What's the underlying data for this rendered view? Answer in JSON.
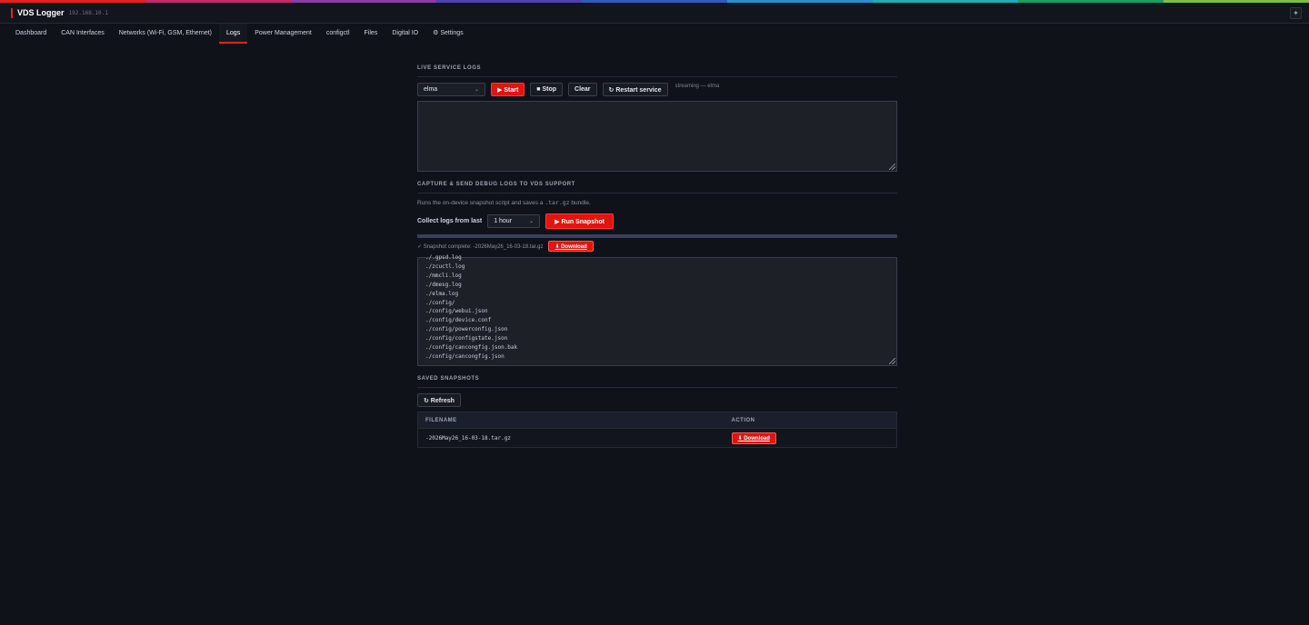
{
  "rainbow_colors": [
    "#e1231f",
    "#c62a6a",
    "#8e3aa8",
    "#4e43b0",
    "#2f5bbd",
    "#2a8ccf",
    "#1bb0b8",
    "#19a060",
    "#78c043"
  ],
  "app": {
    "title": "VDS Logger",
    "ip": "192.168.10.1",
    "corner_icon": "✦"
  },
  "nav": [
    {
      "label": "Dashboard"
    },
    {
      "label": "CAN Interfaces"
    },
    {
      "label": "Networks (Wi-Fi, GSM, Ethernet)"
    },
    {
      "label": "Logs",
      "active": true
    },
    {
      "label": "Power Management"
    },
    {
      "label": "configctl"
    },
    {
      "label": "Files"
    },
    {
      "label": "Digital IO"
    },
    {
      "label": "⚙ Settings"
    }
  ],
  "live": {
    "title": "LIVE SERVICE LOGS",
    "service_value": "elma",
    "start_label": "▶ Start",
    "stop_label": "■ Stop",
    "clear_label": "Clear",
    "restart_label": "↻ Restart service",
    "status": "streaming — elma",
    "log_text": ""
  },
  "capture": {
    "title": "CAPTURE & SEND DEBUG LOGS TO VDS SUPPORT",
    "desc_pre": "Runs the on-device snapshot script and saves a ",
    "desc_code": ".tar.gz",
    "desc_post": " bundle.",
    "collect_label": "Collect logs from last",
    "range_value": "1 hour",
    "run_label": "▶ Run Snapshot",
    "progress": 1.0,
    "complete_text": "✓ Snapshot complete: -2026May26_16-03-18.tar.gz",
    "download_label": "⬇ Download",
    "files": [
      "./.gpsd.log",
      "./zcuctl.log",
      "./mmcli.log",
      "./dmesg.log",
      "./elma.log",
      "./config/",
      "./config/webui.json",
      "./config/device.conf",
      "./config/powerconfig.json",
      "./config/configstate.json",
      "./config/cancongfig.json.bak",
      "./config/cancongfig.json"
    ]
  },
  "saved": {
    "title": "SAVED SNAPSHOTS",
    "refresh_label": "↻ Refresh",
    "columns": [
      "FILENAME",
      "ACTION"
    ],
    "rows": [
      {
        "filename": "-2026May26_16-03-18.tar.gz",
        "action": "⬇ Download"
      }
    ]
  }
}
